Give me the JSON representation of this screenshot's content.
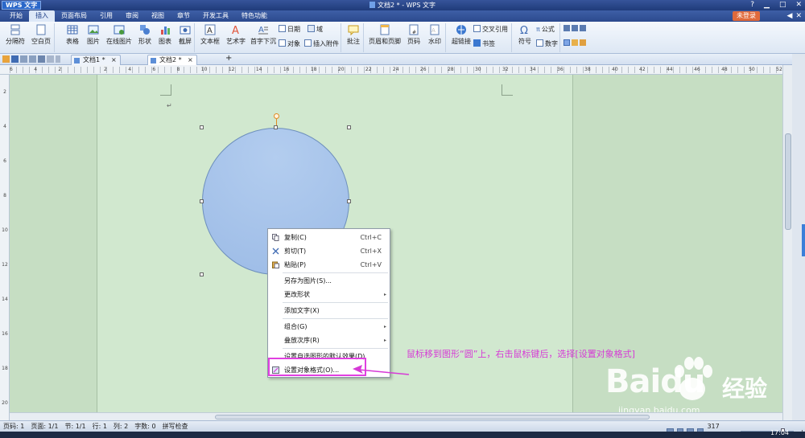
{
  "titlebar": {
    "app_button": "WPS 文字",
    "window_title": "文档2 * - WPS 文字",
    "controls": [
      "?",
      "▁",
      "□",
      "✕"
    ]
  },
  "menubar": {
    "tabs": [
      "开始",
      "插入",
      "页面布局",
      "引用",
      "审阅",
      "视图",
      "章节",
      "开发工具",
      "特色功能"
    ],
    "active_tab": "插入",
    "login": "未登录",
    "right_icons": [
      "◀",
      "✕"
    ]
  },
  "ribbon": {
    "page_break": "分隔符",
    "blank_page": "空白页",
    "table": "表格",
    "picture": "图片",
    "online_picture": "在线图片",
    "shapes": "形状",
    "chart": "图表",
    "screenshot": "截屏",
    "textbox": "文本框",
    "art_text": "艺术字",
    "drop_cap": "首字下沉",
    "date": "日期",
    "field": "域",
    "object": "对象",
    "insert_attachment": "插入附件",
    "comment": "批注",
    "header_footer": "页眉和页脚",
    "page_number": "页码",
    "watermark": "水印",
    "hyperlink": "超链接",
    "cross_ref": "交叉引用",
    "bookmark": "书签",
    "symbol": "符号",
    "formula": "公式",
    "number": "数字"
  },
  "doc_tabs": [
    {
      "label": "文档1 *"
    },
    {
      "label": "文档2 *"
    }
  ],
  "doc_tab_add": "+",
  "ruler_numbers": [
    "6",
    "4",
    "2",
    "",
    "2",
    "4",
    "6",
    "8",
    "10",
    "12",
    "14",
    "16",
    "18",
    "20",
    "22",
    "24",
    "26",
    "28",
    "30",
    "32",
    "34",
    "36",
    "38",
    "40",
    "42",
    "44",
    "46",
    "48",
    "50",
    "52"
  ],
  "vruler_numbers": [
    "2",
    "4",
    "6",
    "8",
    "10",
    "12",
    "14",
    "16",
    "18",
    "20"
  ],
  "document": {
    "paragraph_mark": "↵"
  },
  "context_menu": {
    "items": [
      {
        "label": "复制(C)",
        "shortcut": "Ctrl+C",
        "icon": "copy-icon"
      },
      {
        "label": "剪切(T)",
        "shortcut": "Ctrl+X",
        "icon": "cut-icon"
      },
      {
        "label": "粘贴(P)",
        "shortcut": "Ctrl+V",
        "icon": "paste-icon"
      },
      {
        "label": "另存为图片(S)..."
      },
      {
        "label": "更改形状",
        "submenu": true
      },
      {
        "label": "添加文字(X)"
      },
      {
        "label": "组合(G)",
        "submenu": true
      },
      {
        "label": "叠放次序(R)",
        "submenu": true
      },
      {
        "label": "设置自选图形的默认效果(D)"
      },
      {
        "label": "设置对象格式(O)...",
        "icon": "format-object-icon"
      }
    ],
    "submenu_arrow": "▸"
  },
  "annotation": "鼠标移到图形“圆”上，右击鼠标键后，选择[设置对象格式]",
  "watermark": {
    "brand": "Baidu",
    "cn": "经验",
    "url": "jingyan.baidu.com"
  },
  "statusbar": {
    "page_num": "页码: 1",
    "page": "页面: 1/1",
    "section": "节: 1/1",
    "line": "行: 1",
    "column": "列: 2",
    "word_count": "字数: 0",
    "spell_check": "拼写检查",
    "zoom": "317 %",
    "zoom_minus": "−",
    "zoom_plus": "+"
  },
  "taskbar": {
    "clock": "17:04"
  },
  "colors": {
    "annotation": "#d63ad6",
    "page": "#d1e8cf",
    "circle_fill": "#a8c6ec",
    "title_bar": "#2b4a8e"
  }
}
